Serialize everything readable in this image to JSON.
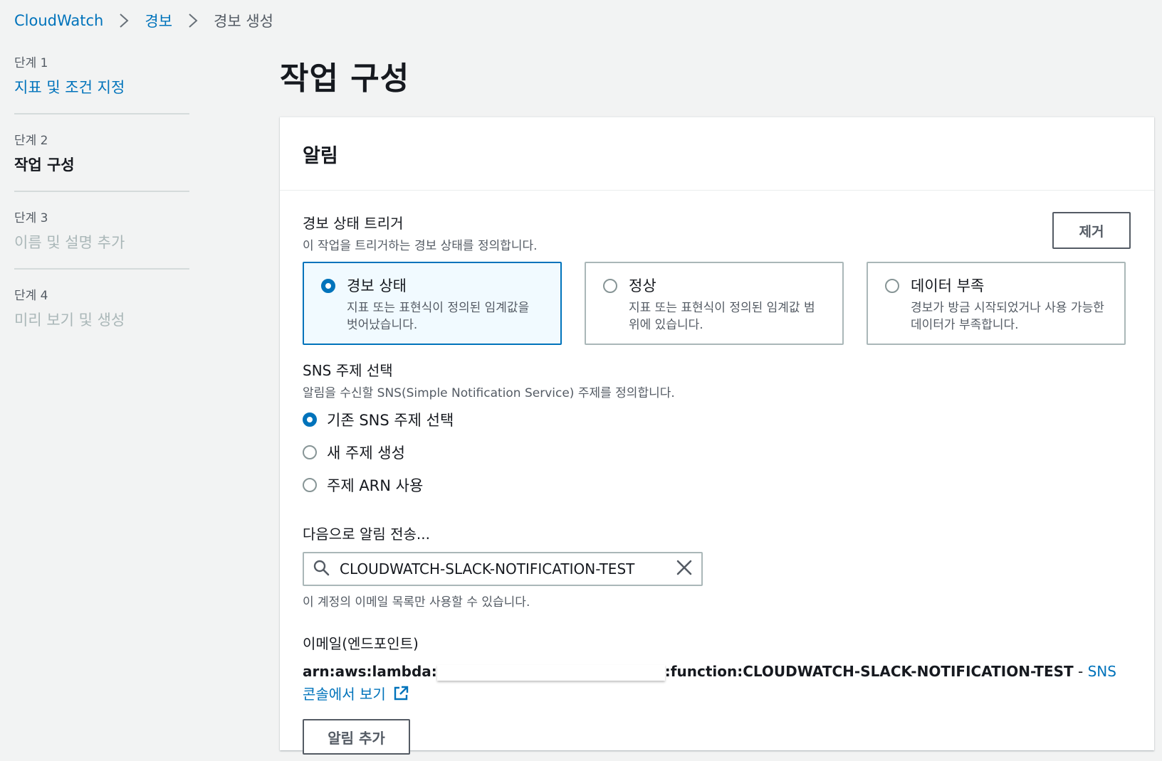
{
  "breadcrumb": {
    "items": [
      "CloudWatch",
      "경보"
    ],
    "current": "경보 생성"
  },
  "steps": [
    {
      "num": "단계 1",
      "title": "지표 및 조건 지정"
    },
    {
      "num": "단계 2",
      "title": "작업 구성"
    },
    {
      "num": "단계 3",
      "title": "이름 및 설명 추가"
    },
    {
      "num": "단계 4",
      "title": "미리 보기 및 생성"
    }
  ],
  "page_title": "작업 구성",
  "panel": {
    "title": "알림",
    "trigger": {
      "label": "경보 상태 트리거",
      "desc": "이 작업을 트리거하는 경보 상태를 정의합니다.",
      "remove_label": "제거",
      "options": [
        {
          "label": "경보 상태",
          "desc": "지표 또는 표현식이 정의된 임계값을 벗어났습니다.",
          "selected": true
        },
        {
          "label": "정상",
          "desc": "지표 또는 표현식이 정의된 임계값 범위에 있습니다.",
          "selected": false
        },
        {
          "label": "데이터 부족",
          "desc": "경보가 방금 시작되었거나 사용 가능한 데이터가 부족합니다.",
          "selected": false
        }
      ]
    },
    "sns": {
      "label": "SNS 주제 선택",
      "desc": "알림을 수신할 SNS(Simple Notification Service) 주제를 정의합니다.",
      "options": [
        {
          "label": "기존 SNS 주제 선택",
          "selected": true
        },
        {
          "label": "새 주제 생성",
          "selected": false
        },
        {
          "label": "주제 ARN 사용",
          "selected": false
        }
      ]
    },
    "send_to": {
      "label": "다음으로 알림 전송...",
      "value": "CLOUDWATCH-SLACK-NOTIFICATION-TEST",
      "hint": "이 계정의 이메일 목록만 사용할 수 있습니다."
    },
    "endpoint": {
      "label": "이메일(엔드포인트)",
      "arn_prefix": "arn:aws:lambda:",
      "arn_suffix": ":function:CLOUDWATCH-SLACK-NOTIFICATION-TEST",
      "sep": " - ",
      "console_link": "SNS 콘솔에서 보기"
    },
    "add_label": "알림 추가"
  },
  "colors": {
    "link": "#0073bb",
    "selected_border": "#0073bb",
    "selected_bg": "#f1faff"
  }
}
